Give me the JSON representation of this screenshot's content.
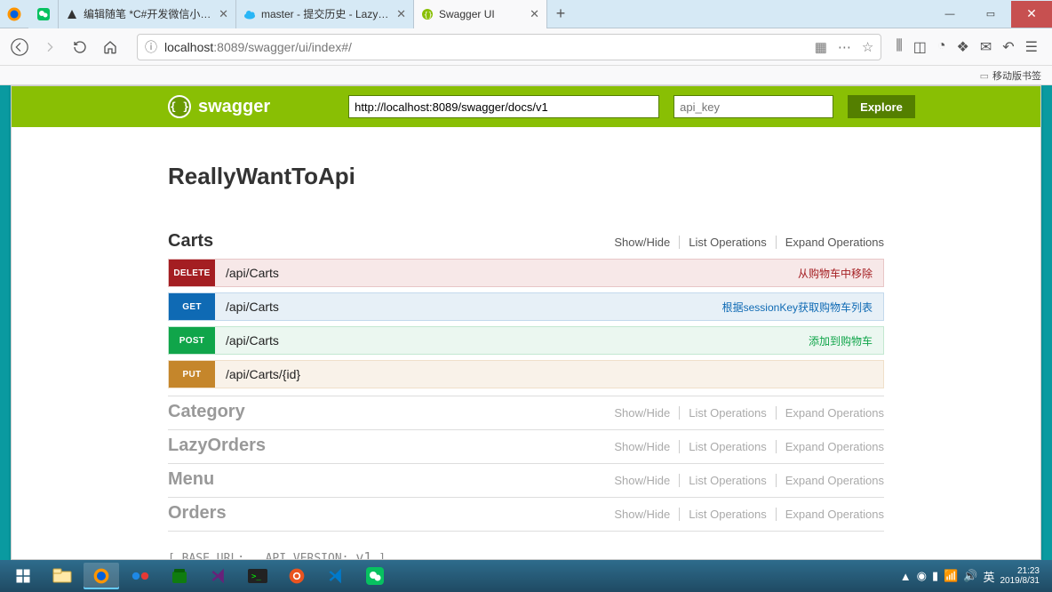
{
  "browser": {
    "tabs": [
      {
        "title": "",
        "favicon": "wechat"
      },
      {
        "title": "编辑随笔 *C#开发微信小程序",
        "favicon": "nav-dark"
      },
      {
        "title": "master - 提交历史 - LazyOrde",
        "favicon": "cloud"
      },
      {
        "title": "Swagger UI",
        "favicon": "swagger",
        "active": true
      }
    ],
    "url_prefix": "localhost",
    "url_rest": ":8089/swagger/ui/index#/",
    "bookmark_label": "移动版书签"
  },
  "swagger": {
    "brand": "swagger",
    "api_url_value": "http://localhost:8089/swagger/docs/v1",
    "api_key_placeholder": "api_key",
    "explore_label": "Explore",
    "api_title": "ReallyWantToApi",
    "actions": {
      "showhide": "Show/Hide",
      "list": "List Operations",
      "expand": "Expand Operations"
    },
    "resources": [
      {
        "name": "Carts",
        "expanded": true,
        "ops": [
          {
            "method": "DELETE",
            "path": "/api/Carts",
            "desc": "从购物车中移除",
            "cls": "op-delete"
          },
          {
            "method": "GET",
            "path": "/api/Carts",
            "desc": "根据sessionKey获取购物车列表",
            "cls": "op-get"
          },
          {
            "method": "POST",
            "path": "/api/Carts",
            "desc": "添加到购物车",
            "cls": "op-post"
          },
          {
            "method": "PUT",
            "path": "/api/Carts/{id}",
            "desc": "",
            "cls": "op-put"
          }
        ]
      },
      {
        "name": "Category",
        "expanded": false
      },
      {
        "name": "LazyOrders",
        "expanded": false
      },
      {
        "name": "Menu",
        "expanded": false
      },
      {
        "name": "Orders",
        "expanded": false
      }
    ],
    "footer_prefix": "[ BASE URL: , API VERSION: ",
    "footer_version": "v1",
    "footer_suffix": " ]"
  },
  "taskbar": {
    "time": "21:23",
    "date": "2019/8/31",
    "ime": "英"
  }
}
